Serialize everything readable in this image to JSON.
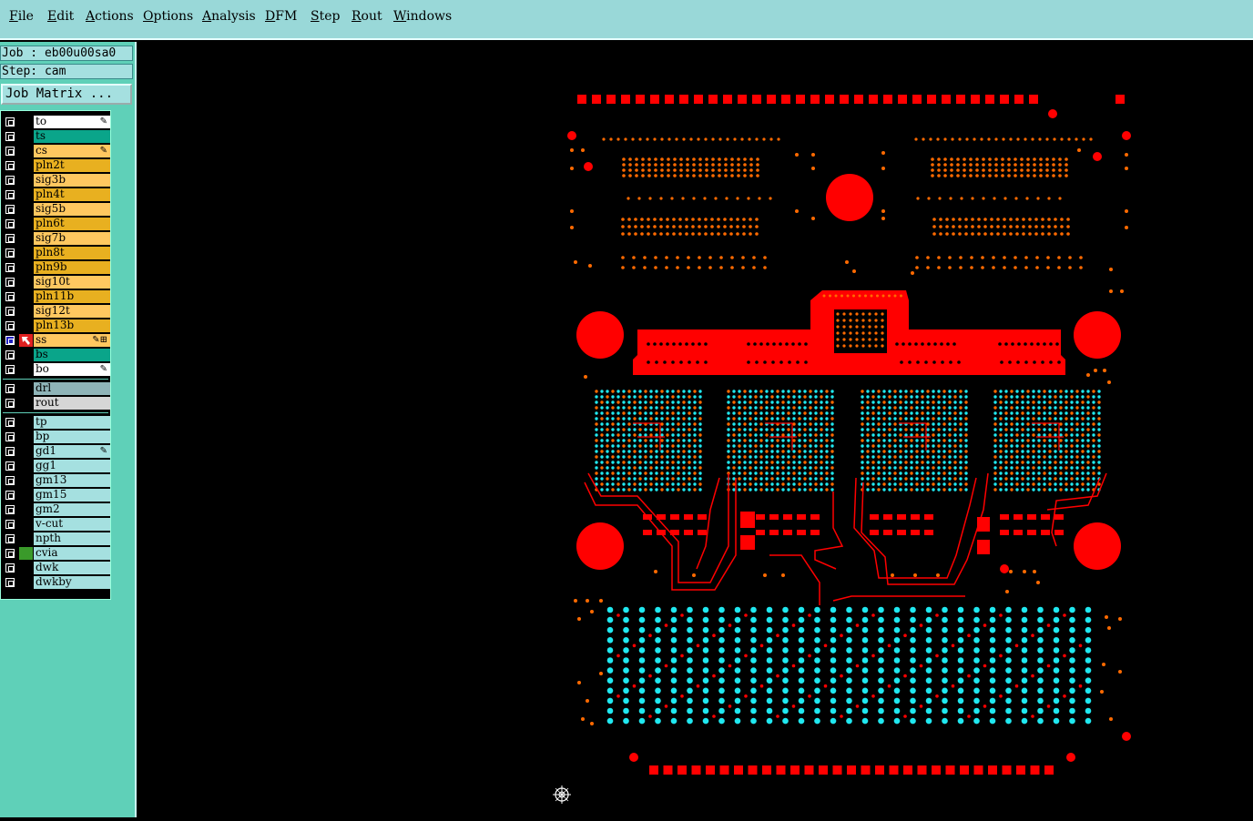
{
  "menu": [
    {
      "label": "File",
      "key": "F",
      "rest": "ile"
    },
    {
      "label": "Edit",
      "key": "E",
      "rest": "dit"
    },
    {
      "label": "Actions",
      "key": "A",
      "rest": "ctions"
    },
    {
      "label": "Options",
      "key": "O",
      "rest": "ptions"
    },
    {
      "label": "Analysis",
      "key": "A",
      "rest": "nalysis"
    },
    {
      "label": "DFM",
      "key": "D",
      "rest": "FM"
    },
    {
      "label": "Step",
      "key": "S",
      "rest": "tep"
    },
    {
      "label": "Rout",
      "key": "R",
      "rest": "out"
    },
    {
      "label": "Windows",
      "key": "W",
      "rest": "indows"
    }
  ],
  "job": {
    "label": "Job : eb00u00sa0",
    "step": "Step: cam",
    "matrix_button": "Job Matrix ..."
  },
  "layers": [
    {
      "name": "to",
      "color": "#ffffff",
      "flag": "✎"
    },
    {
      "name": "ts",
      "color": "#0aa58a",
      "flag": ""
    },
    {
      "name": "cs",
      "color": "#ffc860",
      "flag": "✎"
    },
    {
      "name": "pln2t",
      "color": "#e8b020",
      "flag": ""
    },
    {
      "name": "sig3b",
      "color": "#ffc860",
      "flag": ""
    },
    {
      "name": "pln4t",
      "color": "#e8b020",
      "flag": ""
    },
    {
      "name": "sig5b",
      "color": "#ffc860",
      "flag": ""
    },
    {
      "name": "pln6t",
      "color": "#e8b020",
      "flag": ""
    },
    {
      "name": "sig7b",
      "color": "#ffc860",
      "flag": ""
    },
    {
      "name": "pln8t",
      "color": "#e8b020",
      "flag": ""
    },
    {
      "name": "pln9b",
      "color": "#e8b020",
      "flag": ""
    },
    {
      "name": "sig10t",
      "color": "#ffc860",
      "flag": ""
    },
    {
      "name": "pln11b",
      "color": "#e8b020",
      "flag": ""
    },
    {
      "name": "sig12t",
      "color": "#ffc860",
      "flag": ""
    },
    {
      "name": "pln13b",
      "color": "#e8b020",
      "flag": ""
    },
    {
      "name": "ss",
      "color": "#ffc860",
      "flag": "✎⊞",
      "active": true
    },
    {
      "name": "bs",
      "color": "#0aa58a",
      "flag": ""
    },
    {
      "name": "bo",
      "color": "#ffffff",
      "flag": "✎"
    }
  ],
  "drill_layers": [
    {
      "name": "drl",
      "color": "#8fb4b8",
      "flag": ""
    },
    {
      "name": "rout",
      "color": "#d6d6d6",
      "flag": ""
    }
  ],
  "doc_layers": [
    {
      "name": "tp",
      "color": "#a5e0e0",
      "flag": ""
    },
    {
      "name": "bp",
      "color": "#a5e0e0",
      "flag": ""
    },
    {
      "name": "gd1",
      "color": "#a5e0e0",
      "flag": "✎"
    },
    {
      "name": "gg1",
      "color": "#a5e0e0",
      "flag": ""
    },
    {
      "name": "gm13",
      "color": "#a5e0e0",
      "flag": ""
    },
    {
      "name": "gm15",
      "color": "#a5e0e0",
      "flag": ""
    },
    {
      "name": "gm2",
      "color": "#a5e0e0",
      "flag": ""
    },
    {
      "name": "v-cut",
      "color": "#a5e0e0",
      "flag": ""
    },
    {
      "name": "npth",
      "color": "#a5e0e0",
      "flag": ""
    },
    {
      "name": "cvia",
      "color": "#a5e0e0",
      "flag": "",
      "marked": true
    },
    {
      "name": "dwk",
      "color": "#a5e0e0",
      "flag": ""
    },
    {
      "name": "dwkby",
      "color": "#a5e0e0",
      "flag": ""
    }
  ],
  "colors": {
    "copper": "#ff0000",
    "pad": "#ff6a00",
    "via": "#20e8f0",
    "background": "#000000",
    "menubar": "#99d8d8",
    "sidebar": "#5fd0b8"
  },
  "icons": {
    "origin": "crosshair-origin-icon",
    "checkbox": "layer-checkbox-icon",
    "edit": "pencil-icon"
  }
}
